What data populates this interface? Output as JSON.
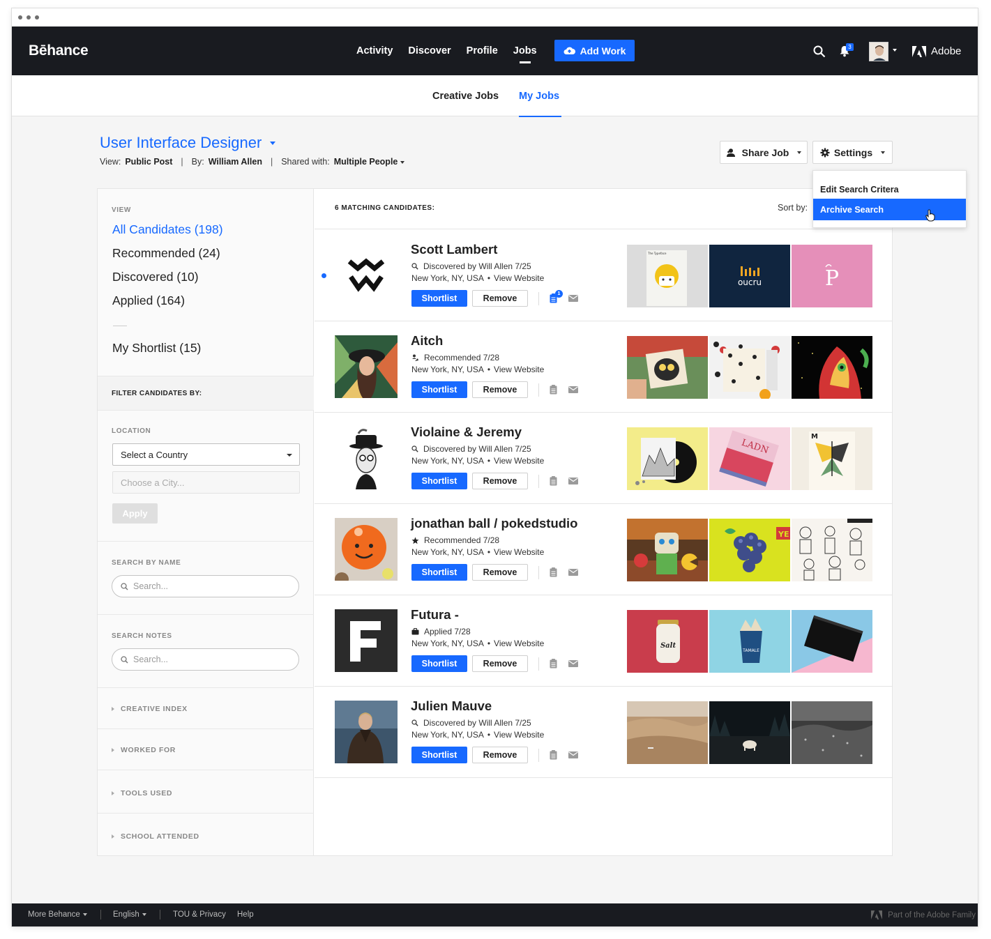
{
  "brand": {
    "logo": "Bēhance",
    "accent": "#1769ff",
    "dark": "#191b20"
  },
  "nav": {
    "links": [
      "Activity",
      "Discover",
      "Profile",
      "Jobs"
    ],
    "active": "Jobs",
    "add_work": "Add Work",
    "notification_count": "3",
    "adobe": "Adobe"
  },
  "subnav": {
    "tabs": [
      "Creative Jobs",
      "My Jobs"
    ],
    "active": "My Jobs"
  },
  "job": {
    "title": "User Interface Designer",
    "view_label": "View:",
    "view_value": "Public Post",
    "by_label": "By:",
    "by_value": "William Allen",
    "shared_label": "Shared with:",
    "shared_value": "Multiple People"
  },
  "actions": {
    "share_job": "Share Job",
    "settings": "Settings"
  },
  "settings_menu": {
    "items": [
      "Edit Search Critera",
      "Archive Search"
    ],
    "highlighted": "Archive Search"
  },
  "sidebar": {
    "view_label": "VIEW",
    "views": [
      "All Candidates (198)",
      "Recommended (24)",
      "Discovered (10)",
      "Applied (164)"
    ],
    "active_view": "All Candidates (198)",
    "shortlist": "My Shortlist (15)",
    "filter_heading": "FILTER CANDIDATES BY:",
    "location_label": "LOCATION",
    "country_value": "Select a Country",
    "city_placeholder": "Choose a City...",
    "apply": "Apply",
    "search_name_label": "SEARCH BY NAME",
    "search_name_placeholder": "Search...",
    "search_notes_label": "SEARCH NOTES",
    "search_notes_placeholder": "Search...",
    "collapsibles": [
      "CREATIVE INDEX",
      "WORKED FOR",
      "TOOLS USED",
      "SCHOOL ATTENDED"
    ]
  },
  "results": {
    "count_label": "6 MATCHING CANDIDATES:",
    "sort_label": "Sort by:",
    "shortlist_label": "Shortlist",
    "remove_label": "Remove",
    "view_website": "View Website",
    "candidates": [
      {
        "name": "Scott Lambert",
        "status_icon": "search-icon",
        "status": "Discovered by Will Allen 7/25",
        "location": "New York, NY, USA",
        "note_count": "1",
        "unread": true,
        "thumb_texts": [
          "The Typeface",
          "oucru",
          "P"
        ]
      },
      {
        "name": "Aitch",
        "status_icon": "recommend-icon",
        "status": "Recommended 7/28",
        "location": "New York, NY, USA"
      },
      {
        "name": "Violaine & Jeremy",
        "status_icon": "search-icon",
        "status": "Discovered by Will Allen 7/25",
        "location": "New York, NY, USA"
      },
      {
        "name": "jonathan ball / pokedstudio",
        "status_icon": "star-icon",
        "status": "Recommended 7/28",
        "location": "New York, NY, USA"
      },
      {
        "name": "Futura -",
        "status_icon": "briefcase-icon",
        "status": "Applied 7/28",
        "location": "New York, NY, USA"
      },
      {
        "name": "Julien Mauve",
        "status_icon": "search-icon",
        "status": "Discovered by Will Allen 7/25",
        "location": "New York, NY, USA"
      }
    ]
  },
  "footer": {
    "more": "More Behance",
    "language": "English",
    "tou": "TOU & Privacy",
    "help": "Help",
    "family": "Part of the Adobe Family"
  }
}
